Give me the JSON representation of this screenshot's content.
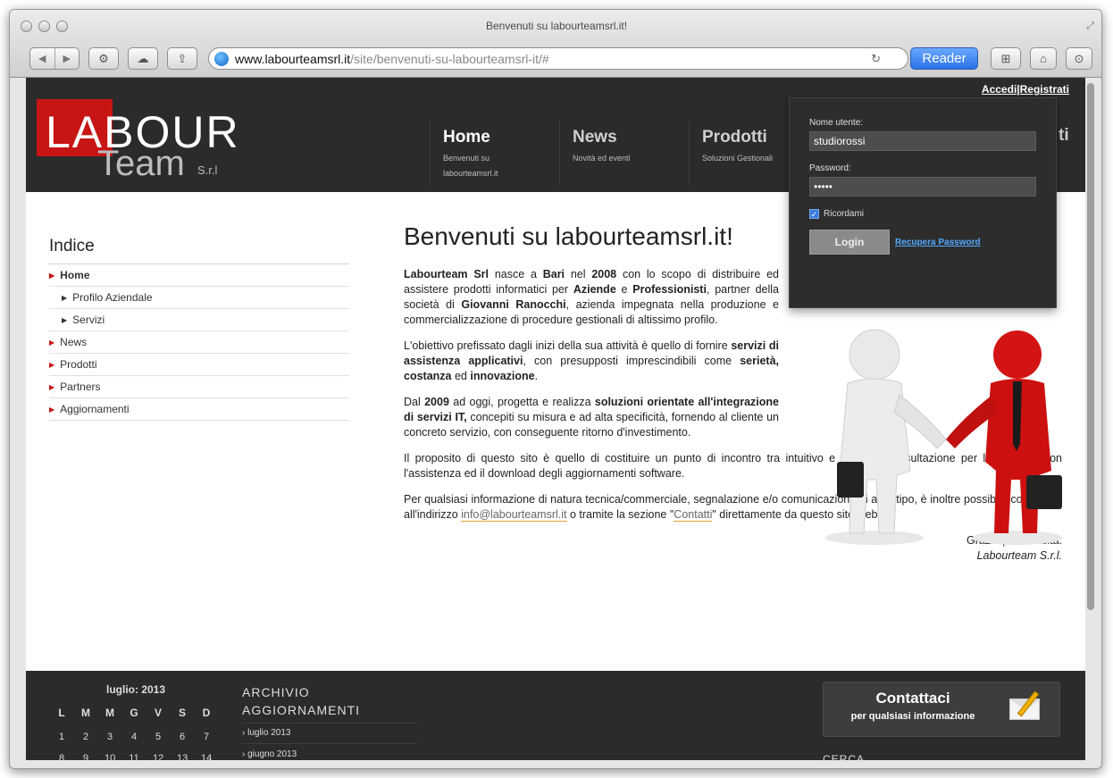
{
  "browser": {
    "window_title": "Benvenuti su labourteamsrl.it!",
    "url_host": "www.labourteamsrl.it",
    "url_path": "/site/benvenuti-su-labourteamsrl-it/#",
    "reader_label": "Reader",
    "reload_icon": "reload-icon"
  },
  "header": {
    "accedi": "Accedi",
    "separator": "|",
    "registrati": "Registrati",
    "logo_main": "LABOUR",
    "logo_sub": "Team",
    "logo_srl": "S.r.l",
    "nav": [
      {
        "title": "Home",
        "subtitle": "Benvenuti su labourteamsrl.it"
      },
      {
        "title": "News",
        "subtitle": "Novità ed eventi"
      },
      {
        "title": "Prodotti",
        "subtitle": "Soluzioni Gestionali"
      }
    ],
    "nav_partial_title": "ti"
  },
  "login": {
    "user_label": "Nome utente:",
    "user_value": "studiorossi",
    "password_label": "Password:",
    "password_value": "•••••",
    "remember_label": "Ricordami",
    "remember_checked": true,
    "login_button": "Login",
    "recover_link": "Recupera Password"
  },
  "sidebar": {
    "title": "Indice",
    "items": [
      {
        "label": "Home",
        "level": 0
      },
      {
        "label": "Profilo Aziendale",
        "level": 1
      },
      {
        "label": "Servizi",
        "level": 1
      },
      {
        "label": "News",
        "level": 0
      },
      {
        "label": "Prodotti",
        "level": 0
      },
      {
        "label": "Partners",
        "level": 0
      },
      {
        "label": "Aggiornamenti",
        "level": 0
      }
    ]
  },
  "main": {
    "heading": "Benvenuti su labourteamsrl.it!",
    "p1": {
      "a": "Labourteam Srl",
      "b": " nasce a ",
      "c": "Bari",
      "d": " nel ",
      "e": "2008",
      "f": " con lo scopo di distribuire ed assistere prodotti informatici per ",
      "g": "Aziende",
      "h": " e ",
      "i": "Professionisti",
      "j": ", partner della società di ",
      "k": "Giovanni Ranocchi",
      "l": ", azienda impegnata nella produzione e commercializzazione di procedure gestionali di altissimo profilo."
    },
    "p2": {
      "a": "L'obiettivo prefissato dagli inizi della sua attività è quello di fornire ",
      "b": "servizi di assistenza applicativi",
      "c": ", con presupposti imprescindibili come ",
      "d": "serietà, costanza",
      "e": " ed ",
      "f": "innovazione",
      "g": "."
    },
    "p3": {
      "a": "Dal ",
      "b": "2009",
      "c": " ad oggi, progetta e realizza ",
      "d": "soluzioni orientate all'integrazione di servizi IT,",
      "e": " concepiti su misura e ad alta specificità, fornendo al cliente un concreto servizio, con conseguente ritorno d'investimento."
    },
    "p4": "Il proposito di questo sito è quello di costituire un punto di incontro tra intuitivo e di facile consultazione per l'interfaccia con l'assistenza ed il download degli aggiornamenti software.",
    "p5": {
      "a": "Per qualsiasi informazione di natura tecnica/commerciale, segnalazione e/o comunicazione di altro tipo, è inoltre possibile contattarci all'indirizzo ",
      "email": "info@labourteamsrl.it",
      "b": " o tramite la sezione \"",
      "contatti": "Contatti",
      "c": "\" direttamente da questo sito web."
    },
    "thanks": "Grazie per la visita.",
    "signature": "Labourteam S.r.l."
  },
  "footer": {
    "calendar_title": "luglio: 2013",
    "days": [
      "L",
      "M",
      "M",
      "G",
      "V",
      "S",
      "D"
    ],
    "week1": [
      "1",
      "2",
      "3",
      "4",
      "5",
      "6",
      "7"
    ],
    "week2": [
      "8",
      "9",
      "10",
      "11",
      "12",
      "13",
      "14"
    ],
    "archive_title": "ARCHIVIO AGGIORNAMENTI",
    "archive_items": [
      "luglio 2013",
      "giugno 2013"
    ],
    "contact_title": "Contattaci",
    "contact_sub": "per qualsiasi informazione",
    "cerca": "CERCA"
  }
}
